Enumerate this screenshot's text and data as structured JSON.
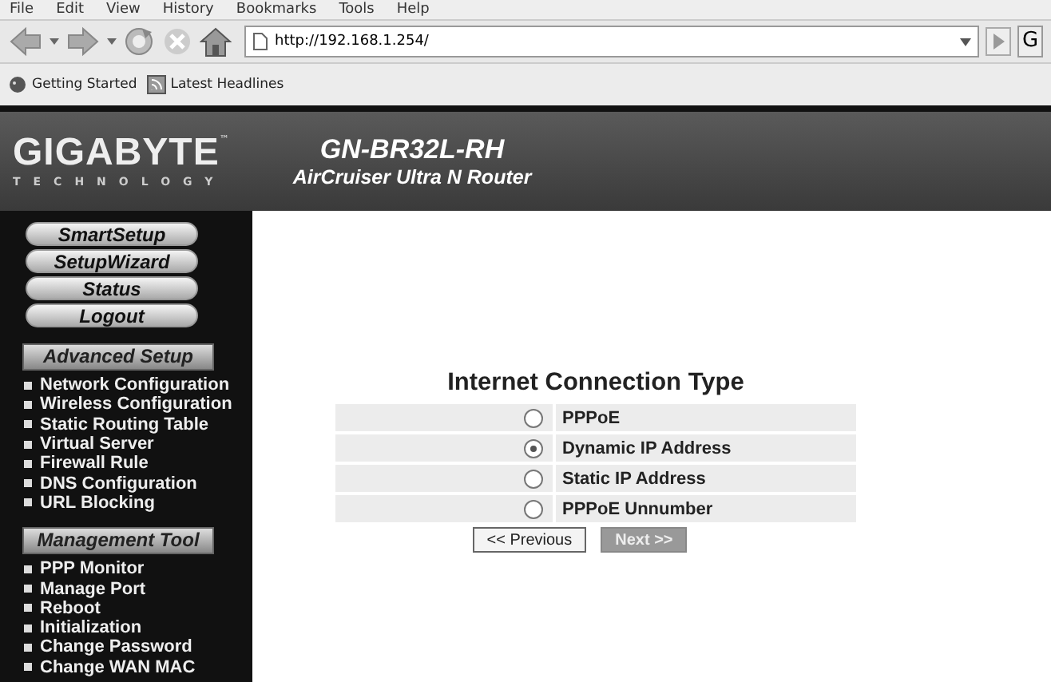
{
  "menu_bar": [
    "File",
    "Edit",
    "View",
    "History",
    "Bookmarks",
    "Tools",
    "Help"
  ],
  "toolbar": {
    "address": "http://192.168.1.254/",
    "search_partial": "G"
  },
  "bookmarks": [
    "Getting Started",
    "Latest Headlines"
  ],
  "header": {
    "logo": "GIGABYTE",
    "logo_tm": "™",
    "logo_sub": "TECHNOLOGY",
    "model": "GN-BR32L-RH",
    "product": "AirCruiser Ultra N Router"
  },
  "sidebar": {
    "buttons": [
      "SmartSetup",
      "SetupWizard",
      "Status",
      "Logout"
    ],
    "sections": [
      {
        "title": "Advanced Setup",
        "items": [
          "Network Configuration",
          "Wireless Configuration",
          "Static Routing Table",
          "Virtual Server",
          "Firewall Rule",
          "DNS Configuration",
          "URL Blocking"
        ]
      },
      {
        "title": "Management Tool",
        "items": [
          "PPP Monitor",
          "Manage Port",
          "Reboot",
          "Initialization",
          "Change Password",
          "Change WAN MAC"
        ]
      }
    ]
  },
  "form": {
    "title": "Internet Connection Type",
    "options": [
      {
        "label": "PPPoE",
        "selected": false
      },
      {
        "label": "Dynamic IP Address",
        "selected": true
      },
      {
        "label": "Static IP Address",
        "selected": false
      },
      {
        "label": "PPPoE Unnumber",
        "selected": false
      }
    ],
    "buttons": [
      {
        "label": "<< Previous",
        "disabled": false
      },
      {
        "label": "Next >>",
        "disabled": true
      }
    ]
  }
}
